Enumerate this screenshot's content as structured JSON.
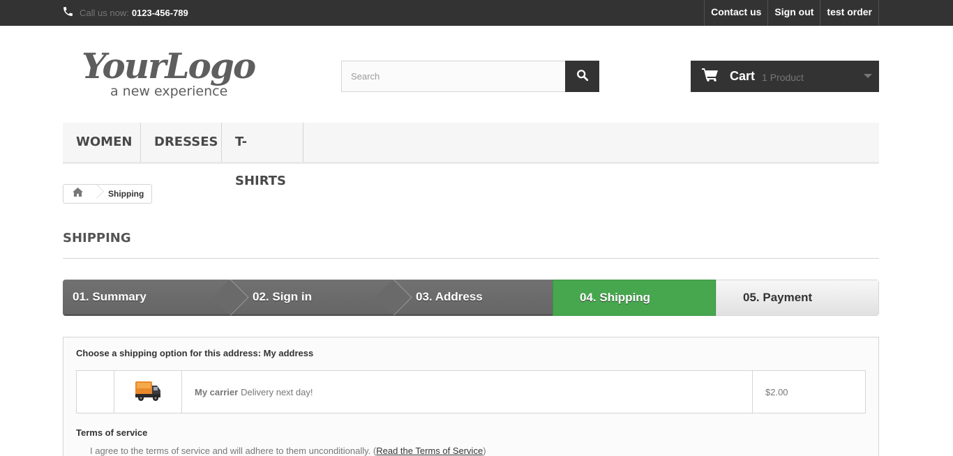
{
  "topbar": {
    "call_label": "Call us now:",
    "phone": "0123-456-789",
    "links": [
      "Contact us",
      "Sign out",
      "test order"
    ]
  },
  "header": {
    "logo_main": "YourLogo",
    "logo_tagline": "a new experience",
    "search_placeholder": "Search",
    "cart_label": "Cart",
    "cart_qty": "1 Product"
  },
  "menu": [
    "WOMEN",
    "DRESSES",
    "T-SHIRTS"
  ],
  "breadcrumb": {
    "current": "Shipping"
  },
  "page_title": "SHIPPING",
  "steps": [
    {
      "label": "01. Summary",
      "state": "done"
    },
    {
      "label": "02. Sign in",
      "state": "done"
    },
    {
      "label": "03. Address",
      "state": "done"
    },
    {
      "label": "04. Shipping",
      "state": "current"
    },
    {
      "label": "05. Payment",
      "state": "todo"
    }
  ],
  "shipping": {
    "choose_text": "Choose a shipping option for this address: My address",
    "carrier_name": "My carrier",
    "carrier_delay": "Delivery next day!",
    "price": "$2.00"
  },
  "terms": {
    "title": "Terms of service",
    "agree_text": "I agree to the terms of service and will adhere to them unconditionally.",
    "read_open": "(",
    "read_link": "Read the Terms of Service",
    "read_close": ")"
  },
  "colors": {
    "topbar": "#333333",
    "step_current": "#46a74e",
    "step_done": "#6b6a6a"
  }
}
